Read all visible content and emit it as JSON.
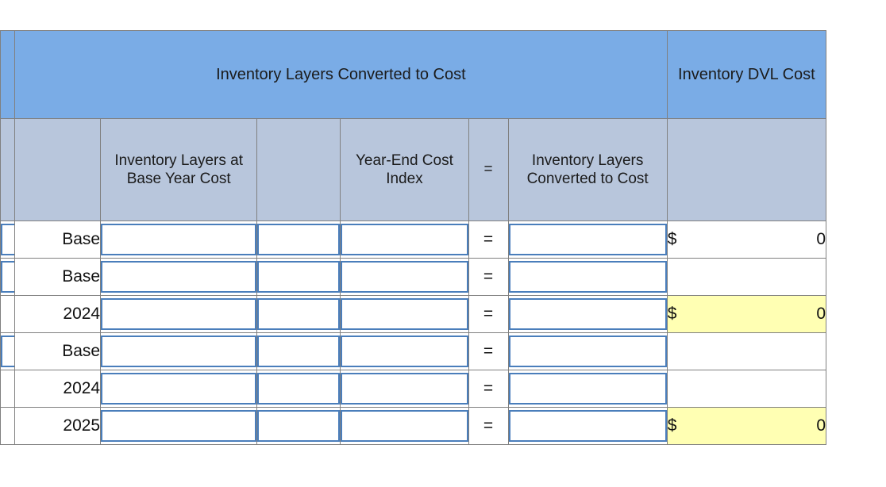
{
  "table": {
    "header_top": {
      "stub": "",
      "group_title": "Inventory Layers Converted to Cost",
      "dvl_title": "Inventory DVL Cost"
    },
    "header_sub": {
      "stub": "",
      "year": "",
      "base_year_cost": "Inventory Layers at Base Year Cost",
      "multiply": "",
      "cost_index": "Year-End Cost Index",
      "equals": "=",
      "converted": "Inventory Layers Converted to Cost",
      "dvl": ""
    },
    "rows": [
      {
        "year_label": "Base",
        "base_year_cost": "",
        "multiply": "",
        "cost_index": "",
        "equals": "=",
        "converted": "",
        "dvl_symbol": "$",
        "dvl_amount": "0",
        "dvl_shown": true,
        "dvl_highlight": false,
        "stub_entry": true
      },
      {
        "year_label": "Base",
        "base_year_cost": "",
        "multiply": "",
        "cost_index": "",
        "equals": "=",
        "converted": "",
        "dvl_symbol": "",
        "dvl_amount": "",
        "dvl_shown": false,
        "dvl_highlight": false,
        "stub_entry": true
      },
      {
        "year_label": "2024",
        "base_year_cost": "",
        "multiply": "",
        "cost_index": "",
        "equals": "=",
        "converted": "",
        "dvl_symbol": "$",
        "dvl_amount": "0",
        "dvl_shown": true,
        "dvl_highlight": true,
        "stub_entry": false
      },
      {
        "year_label": "Base",
        "base_year_cost": "",
        "multiply": "",
        "cost_index": "",
        "equals": "=",
        "converted": "",
        "dvl_symbol": "",
        "dvl_amount": "",
        "dvl_shown": false,
        "dvl_highlight": false,
        "stub_entry": true
      },
      {
        "year_label": "2024",
        "base_year_cost": "",
        "multiply": "",
        "cost_index": "",
        "equals": "=",
        "converted": "",
        "dvl_symbol": "",
        "dvl_amount": "",
        "dvl_shown": false,
        "dvl_highlight": false,
        "stub_entry": false
      },
      {
        "year_label": "2025",
        "base_year_cost": "",
        "multiply": "",
        "cost_index": "",
        "equals": "=",
        "converted": "",
        "dvl_symbol": "$",
        "dvl_amount": "0",
        "dvl_shown": true,
        "dvl_highlight": true,
        "stub_entry": false
      }
    ],
    "colors": {
      "header_band": "#7aace6",
      "header_subband": "#b8c6dc",
      "entry_border": "#4a7ebb",
      "highlight": "#ffffb3",
      "grid_line": "#808080"
    },
    "input_placeholder": ""
  }
}
